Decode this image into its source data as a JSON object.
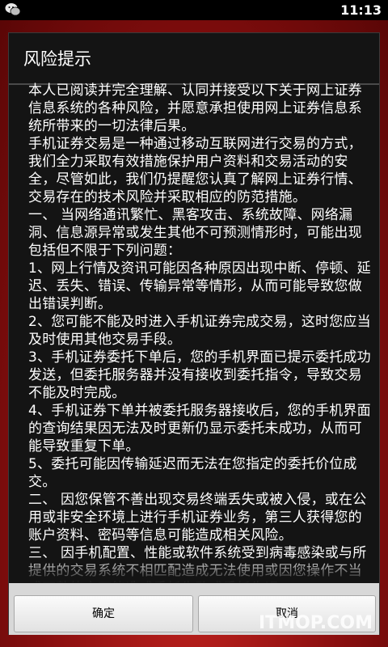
{
  "status_bar": {
    "time": "11:13",
    "app_icon": "wechat-icon"
  },
  "dialog": {
    "title": "风险提示",
    "paragraphs": [
      "本人已阅读并完全理解、认同并接受以下关于网上证券信息系统的各种风险，并愿意承担使用网上证券信息系统所带来的一切法律后果。",
      "手机证券交易是一种通过移动互联网进行交易的方式，我们全力采取有效措施保护用户资料和交易活动的安全，尽管如此，我们仍提醒您认真了解网上证券行情、交易存在的技术风险并采取相应的防范措施。",
      "一、 当网络通讯繁忙、黑客攻击、系统故障、网络漏洞、信息源异常或发生其他不可预测情形时，可能出现包括但不限于下列问题：",
      "1、网上行情及资讯可能因各种原因出现中断、停顿、延迟、丢失、错误、传输异常等情形，从而可能导致您做出错误判断。",
      "2、您可能不能及时进入手机证券完成交易，这时您应当及时使用其他交易手段。",
      "3、手机证券委托下单后，您的手机界面已提示委托成功发送，但委托服务器并没有接收到委托指令，导致交易不能及时完成。",
      "4、手机证券下单并被委托服务器接收后，您的手机界面的查询结果因无法及时更新仍显示委托未成功，从而可能导致重复下单。",
      "5、委托可能因传输延迟而无法在您指定的委托价位成交。",
      "二、 因您保管不善出现交易终端丢失或被入侵，或在公用或非安全环境上进行手机证券业务，第三人获得您的账户资料、密码等信息可能造成相关风险。",
      "三、 因手机配置、性能或软件系统受到病毒感染或与所提供的交易系统不相匹配造成无法使用或因您操作不当或不熟练亦可能造成委托失败或委托失误。"
    ],
    "ok_label": "确定",
    "cancel_label": "取消"
  },
  "watermark": "ITMOP.COM"
}
